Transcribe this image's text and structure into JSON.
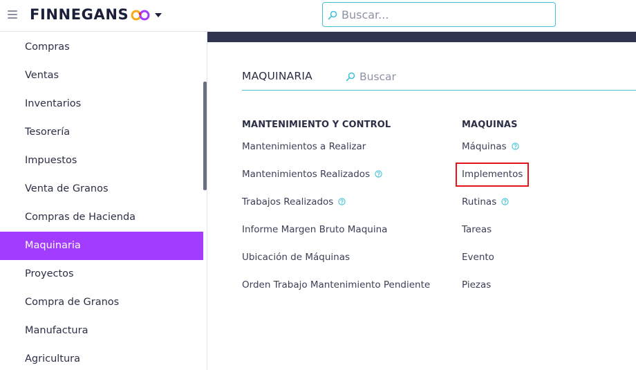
{
  "header": {
    "brand": "FINNEGANS",
    "logo_icon": "infinity-co-logo-icon",
    "logo_colors": [
      "#f7a81b",
      "#e8303a",
      "#a23cff"
    ],
    "search_placeholder": "Buscar..."
  },
  "sidebar": {
    "items": [
      {
        "label": "Compras",
        "active": false
      },
      {
        "label": "Ventas",
        "active": false
      },
      {
        "label": "Inventarios",
        "active": false
      },
      {
        "label": "Tesorería",
        "active": false
      },
      {
        "label": "Impuestos",
        "active": false
      },
      {
        "label": "Venta de Granos",
        "active": false
      },
      {
        "label": "Compras de Hacienda",
        "active": false
      },
      {
        "label": "Maquinaria",
        "active": true
      },
      {
        "label": "Proyectos",
        "active": false
      },
      {
        "label": "Compra de Granos",
        "active": false
      },
      {
        "label": "Manufactura",
        "active": false
      },
      {
        "label": "Agricultura",
        "active": false
      }
    ],
    "active_color": "#a23cff"
  },
  "main": {
    "module_title": "MAQUINARIA",
    "search_placeholder": "Buscar",
    "columns": [
      {
        "title": "MANTENIMIENTO Y CONTROL",
        "links": [
          {
            "label": "Mantenimientos a Realizar",
            "help": false
          },
          {
            "label": "Mantenimientos Realizados",
            "help": true
          },
          {
            "label": "Trabajos Realizados",
            "help": true
          },
          {
            "label": "Informe Margen Bruto Maquina",
            "help": false
          },
          {
            "label": "Ubicación de Máquinas",
            "help": false
          },
          {
            "label": "Orden Trabajo Mantenimiento Pendiente",
            "help": false
          }
        ]
      },
      {
        "title": "MAQUINAS",
        "links": [
          {
            "label": "Máquinas",
            "help": true
          },
          {
            "label": "Implementos",
            "help": false,
            "highlighted": true
          },
          {
            "label": "Rutinas",
            "help": true
          },
          {
            "label": "Tareas",
            "help": false
          },
          {
            "label": "Evento",
            "help": false
          },
          {
            "label": "Piezas",
            "help": false
          }
        ]
      }
    ],
    "accent_color": "#41c1d8",
    "highlight_color": "#e5141b"
  }
}
